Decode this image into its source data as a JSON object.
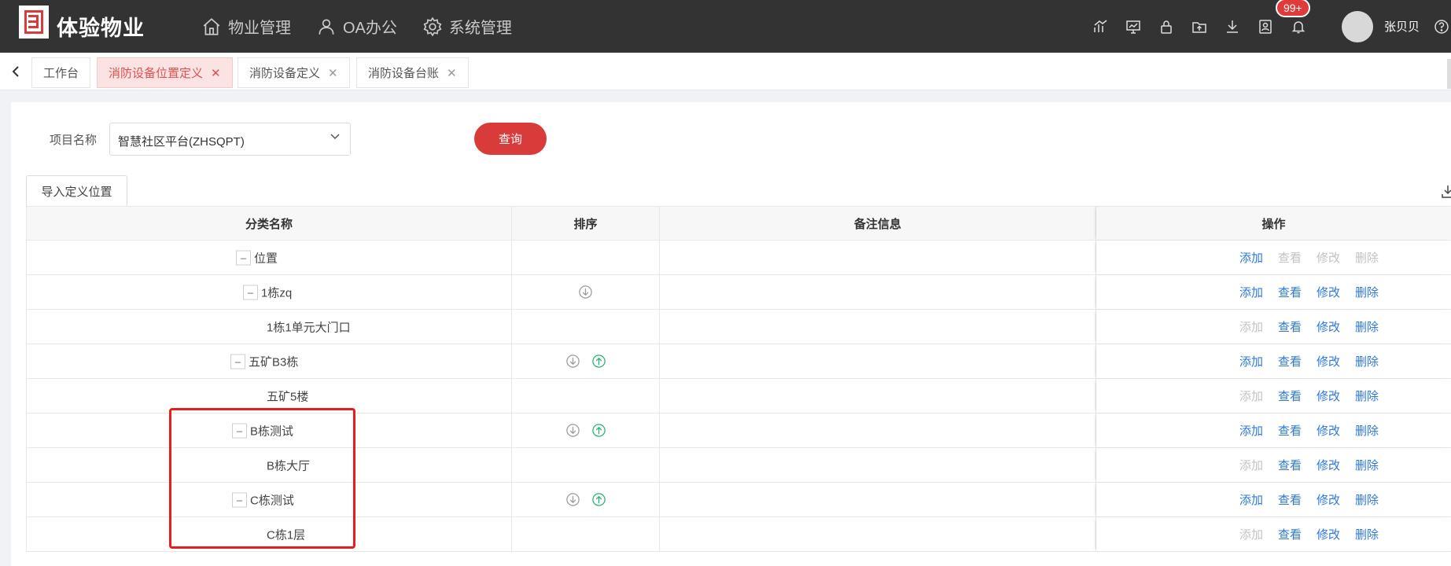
{
  "app": {
    "title": "体验物业",
    "nav": [
      {
        "label": "物业管理",
        "icon": "home-icon"
      },
      {
        "label": "OA办公",
        "icon": "user-icon"
      },
      {
        "label": "系统管理",
        "icon": "gear-icon"
      }
    ],
    "notification_badge": "99+",
    "username": "张贝贝"
  },
  "tabs": [
    {
      "label": "工作台",
      "closable": false,
      "active": false
    },
    {
      "label": "消防设备位置定义",
      "closable": true,
      "active": true
    },
    {
      "label": "消防设备定义",
      "closable": true,
      "active": false
    },
    {
      "label": "消防设备台账",
      "closable": true,
      "active": false
    }
  ],
  "filter": {
    "label": "项目名称",
    "project_value": "智慧社区平台(ZHSQPT)",
    "query_button": "查询"
  },
  "import_button": "导入定义位置",
  "table": {
    "headers": [
      "分类名称",
      "排序",
      "备注信息",
      "操作"
    ],
    "rows": [
      {
        "name": "位置",
        "collapsible": true,
        "sort_down": false,
        "sort_up": false,
        "note": "",
        "ops": {
          "add": true,
          "view": false,
          "edit": false,
          "delete": false
        }
      },
      {
        "name": "1栋zq",
        "collapsible": true,
        "sort_down": true,
        "sort_up": false,
        "note": "",
        "ops": {
          "add": true,
          "view": true,
          "edit": true,
          "delete": true
        }
      },
      {
        "name": "1栋1单元大门口",
        "collapsible": false,
        "sort_down": false,
        "sort_up": false,
        "note": "",
        "ops": {
          "add": false,
          "view": true,
          "edit": true,
          "delete": true
        }
      },
      {
        "name": "五矿B3栋",
        "collapsible": true,
        "sort_down": true,
        "sort_up": true,
        "note": "",
        "ops": {
          "add": true,
          "view": true,
          "edit": true,
          "delete": true
        }
      },
      {
        "name": "五矿5楼",
        "collapsible": false,
        "sort_down": false,
        "sort_up": false,
        "note": "",
        "ops": {
          "add": false,
          "view": true,
          "edit": true,
          "delete": true
        }
      },
      {
        "name": "B栋测试",
        "collapsible": true,
        "sort_down": true,
        "sort_up": true,
        "note": "",
        "ops": {
          "add": true,
          "view": true,
          "edit": true,
          "delete": true
        }
      },
      {
        "name": "B栋大厅",
        "collapsible": false,
        "sort_down": false,
        "sort_up": false,
        "note": "",
        "ops": {
          "add": false,
          "view": true,
          "edit": true,
          "delete": true
        }
      },
      {
        "name": "C栋测试",
        "collapsible": true,
        "sort_down": true,
        "sort_up": true,
        "note": "",
        "ops": {
          "add": true,
          "view": true,
          "edit": true,
          "delete": true
        }
      },
      {
        "name": "C栋1层",
        "collapsible": false,
        "sort_down": false,
        "sort_up": false,
        "note": "",
        "ops": {
          "add": false,
          "view": true,
          "edit": true,
          "delete": true
        }
      }
    ],
    "op_labels": {
      "add": "添加",
      "view": "查看",
      "edit": "修改",
      "delete": "删除"
    },
    "collapse_glyph": "–"
  },
  "colors": {
    "header_bg": "#333333",
    "accent_red": "#d93a3a",
    "link_blue": "#2d78e0",
    "disabled_gray": "#c2c2c2",
    "sort_up_green": "#22b36b"
  }
}
